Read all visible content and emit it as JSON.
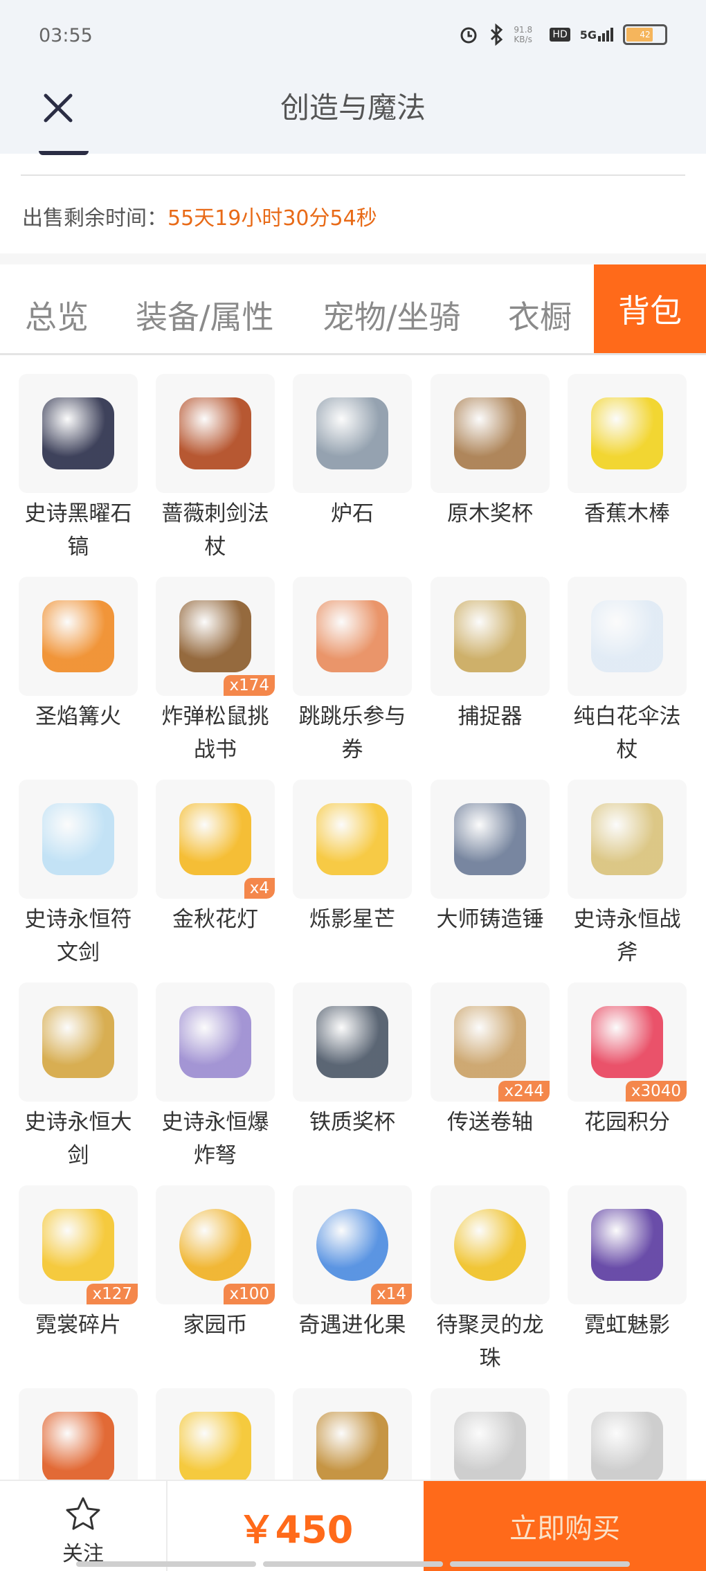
{
  "status_bar": {
    "time": "03:55",
    "net_speed": "91.8\nKB/s",
    "signal": "5G",
    "battery": "42"
  },
  "header": {
    "title": "创造与魔法"
  },
  "sale": {
    "label": "出售剩余时间：",
    "remaining": "55天19小时30分54秒"
  },
  "tabs": [
    {
      "label": "总览"
    },
    {
      "label": "装备/属性"
    },
    {
      "label": "宠物/坐骑"
    },
    {
      "label": "衣橱"
    },
    {
      "label": "背包"
    }
  ],
  "active_tab": "背包",
  "items": [
    {
      "name": "史诗黑曜石镐",
      "qty": "",
      "icon": "pickaxe-icon"
    },
    {
      "name": "蔷薇刺剑法杖",
      "qty": "",
      "icon": "staff-icon"
    },
    {
      "name": "炉石",
      "qty": "",
      "icon": "hearthstone-icon"
    },
    {
      "name": "原木奖杯",
      "qty": "",
      "icon": "trophy-icon"
    },
    {
      "name": "香蕉木棒",
      "qty": "",
      "icon": "banana-icon"
    },
    {
      "name": "圣焰篝火",
      "qty": "",
      "icon": "campfire-icon"
    },
    {
      "name": "炸弹松鼠挑战书",
      "qty": "x174",
      "icon": "wanted-scroll-icon"
    },
    {
      "name": "跳跳乐参与券",
      "qty": "",
      "icon": "ticket-icon"
    },
    {
      "name": "捕捉器",
      "qty": "",
      "icon": "catcher-icon"
    },
    {
      "name": "纯白花伞法杖",
      "qty": "",
      "icon": "umbrella-icon"
    },
    {
      "name": "史诗永恒符文剑",
      "qty": "",
      "icon": "rune-sword-icon"
    },
    {
      "name": "金秋花灯",
      "qty": "x4",
      "icon": "lantern-icon"
    },
    {
      "name": "烁影星芒",
      "qty": "",
      "icon": "star-icon"
    },
    {
      "name": "大师铸造锤",
      "qty": "",
      "icon": "hammer-icon"
    },
    {
      "name": "史诗永恒战斧",
      "qty": "",
      "icon": "battle-axe-icon"
    },
    {
      "name": "史诗永恒大剑",
      "qty": "",
      "icon": "greatsword-icon"
    },
    {
      "name": "史诗永恒爆炸弩",
      "qty": "",
      "icon": "crossbow-icon"
    },
    {
      "name": "铁质奖杯",
      "qty": "",
      "icon": "iron-trophy-icon"
    },
    {
      "name": "传送卷轴",
      "qty": "x244",
      "icon": "scroll-icon"
    },
    {
      "name": "花园积分",
      "qty": "x3040",
      "icon": "flower-icon"
    },
    {
      "name": "霓裳碎片",
      "qty": "x127",
      "icon": "shirt-icon"
    },
    {
      "name": "家园币",
      "qty": "x100",
      "icon": "coin-icon"
    },
    {
      "name": "奇遇进化果",
      "qty": "x14",
      "icon": "fruit-icon"
    },
    {
      "name": "待聚灵的龙珠",
      "qty": "",
      "icon": "dragon-ball-icon"
    },
    {
      "name": "霓虹魅影",
      "qty": "",
      "icon": "neon-car-icon"
    },
    {
      "name": "",
      "qty": "",
      "icon": "rune-rock-icon"
    },
    {
      "name": "",
      "qty": "",
      "icon": "shirt-icon"
    },
    {
      "name": "",
      "qty": "",
      "icon": "badge-icon"
    },
    {
      "name": "",
      "qty": "",
      "icon": "horn-icon"
    },
    {
      "name": "",
      "qty": "",
      "icon": "horn-icon"
    }
  ],
  "footer": {
    "follow_label": "关注",
    "price": "￥450",
    "buy_label": "立即购买"
  },
  "colors": {
    "accent": "#ff6a1a",
    "countdown": "#e86a17",
    "badge": "#f4874b"
  }
}
